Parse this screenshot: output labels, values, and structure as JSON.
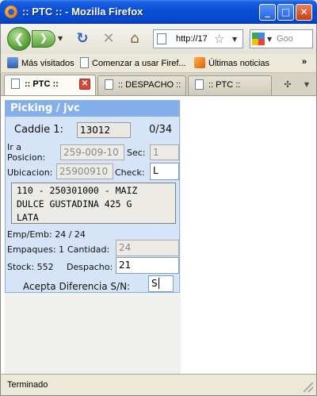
{
  "window": {
    "title": ":: PTC :: - Mozilla Firefox",
    "controls": {
      "minimize": "_",
      "maximize": "□",
      "close": "✕"
    }
  },
  "navbar": {
    "back_glyph": "❮",
    "forward_glyph": "❯",
    "url": "http://17",
    "search_placeholder": "Goo"
  },
  "bookmarks": {
    "items": [
      {
        "label": "Más visitados"
      },
      {
        "label": "Comenzar a usar Firef..."
      },
      {
        "label": "Últimas noticias"
      }
    ],
    "more": "»"
  },
  "tabs": [
    {
      "label": ":: PTC ::",
      "active": true
    },
    {
      "label": ":: DESPACHO ::",
      "active": false
    },
    {
      "label": ":: PTC ::",
      "active": false
    }
  ],
  "form": {
    "header": "Picking / jvc",
    "caddie_label": "Caddie 1:",
    "caddie_value": "13012",
    "caddie_count": "0/34",
    "ir_a_label_line1": "Ir a",
    "ir_a_label_line2": "Posicion:",
    "posicion_value": "259-009-10",
    "sec_label": "Sec:",
    "sec_value": "1",
    "ubicacion_label": "Ubicacion:",
    "ubicacion_value": "25900910",
    "check_label": "Check:",
    "check_value": "L",
    "description_lines": [
      "110 - 250301000 - MAIZ",
      "DULCE GUSTADINA 425 G",
      "LATA"
    ],
    "emp_emb": "Emp/Emb: 24 / 24",
    "empaques_label": "Empaques: 1",
    "cantidad_label": "Cantidad:",
    "cantidad_value": "24",
    "stock_label": "Stock: 552",
    "despacho_label": "Despacho:",
    "despacho_value": "21",
    "acepta_label": "Acepta Diferencia S/N:",
    "acepta_value": "S"
  },
  "status": {
    "text": "Terminado"
  }
}
